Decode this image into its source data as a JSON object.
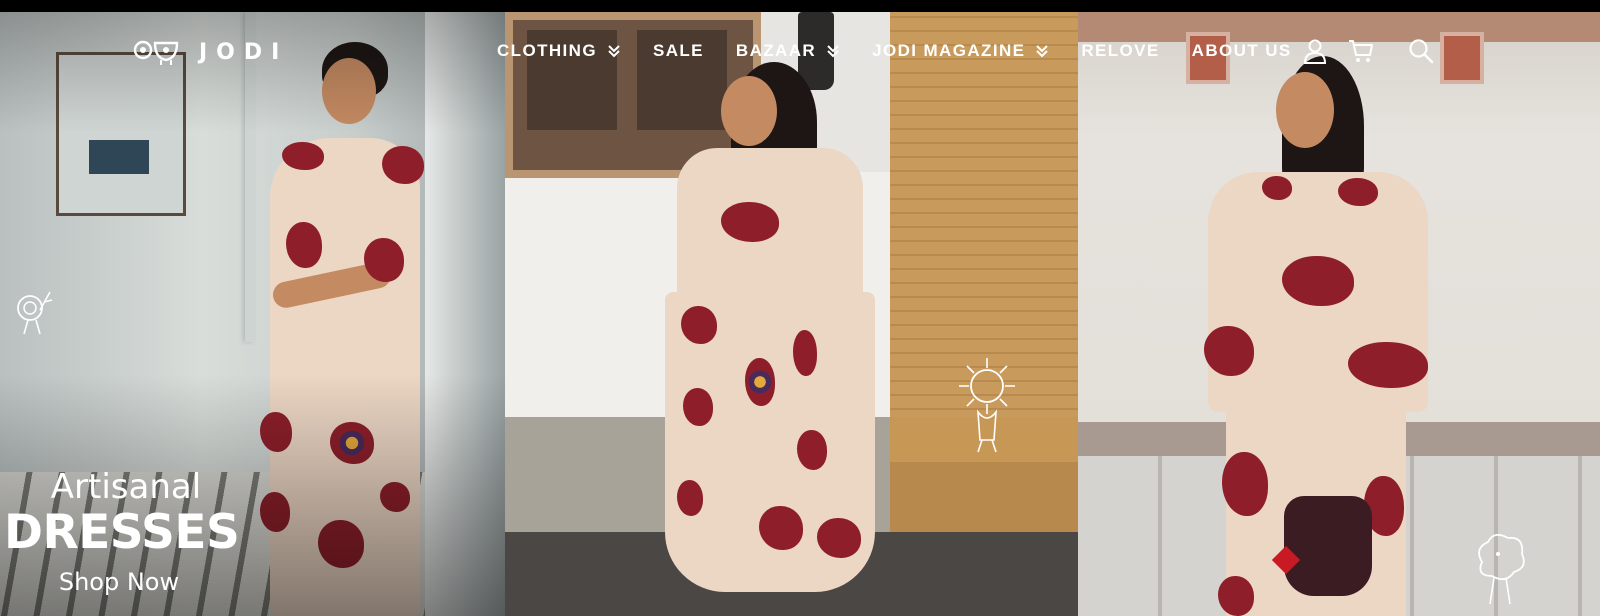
{
  "brand": {
    "name": "JODI",
    "logo_icon": "jodi-logo-icon"
  },
  "nav": {
    "items": [
      {
        "label": "CLOTHING",
        "has_dropdown": true
      },
      {
        "label": "SALE",
        "has_dropdown": false
      },
      {
        "label": "BAZAAR",
        "has_dropdown": true
      },
      {
        "label": "JODI MAGAZINE",
        "has_dropdown": true
      },
      {
        "label": "RELOVE",
        "has_dropdown": false
      },
      {
        "label": "ABOUT US",
        "has_dropdown": false
      }
    ]
  },
  "header_icons": [
    "user-icon",
    "cart-icon",
    "search-icon"
  ],
  "hero": {
    "line1": "Artisanal",
    "line2": "DRESSES",
    "cta": "Shop Now"
  },
  "colors": {
    "nav_text": "#ffffff",
    "dress_base": "#ecd6c4",
    "dress_print": "#8e1f2a"
  }
}
